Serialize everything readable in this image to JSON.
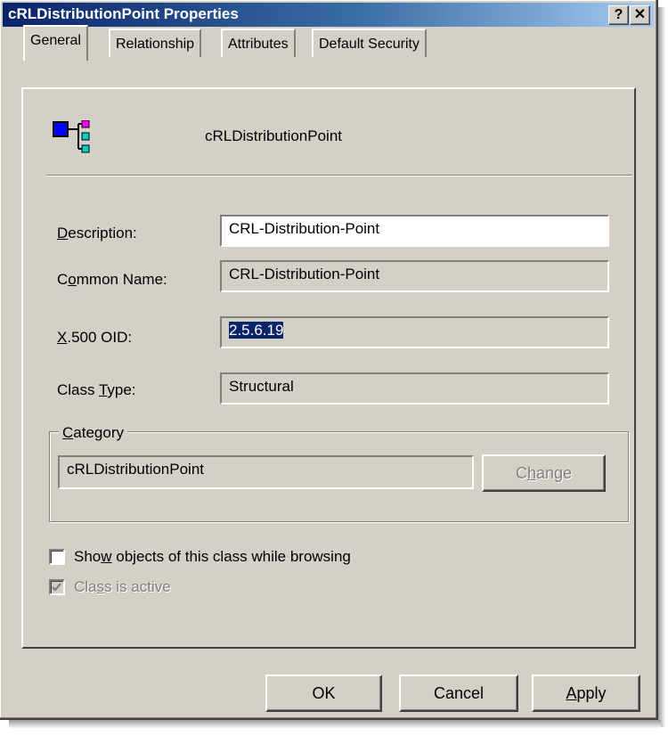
{
  "window": {
    "title": "cRLDistributionPoint Properties",
    "help_label": "?",
    "close_label": "✕"
  },
  "tabs": [
    {
      "label": "General",
      "active": true
    },
    {
      "label": "Relationship",
      "active": false
    },
    {
      "label": "Attributes",
      "active": false
    },
    {
      "label": "Default Security",
      "active": false
    }
  ],
  "header": {
    "class_name": "cRLDistributionPoint",
    "icon": "class-hierarchy-icon"
  },
  "fields": {
    "description": {
      "label_pre": "",
      "label_key": "D",
      "label_post": "escription:",
      "value": "CRL-Distribution-Point"
    },
    "common_name": {
      "label_pre": "C",
      "label_key": "o",
      "label_post": "mmon Name:",
      "value": "CRL-Distribution-Point"
    },
    "oid": {
      "label_pre": "",
      "label_key": "X",
      "label_post": ".500 OID:",
      "value": "2.5.6.19"
    },
    "class_type": {
      "label_pre": "Class ",
      "label_key": "T",
      "label_post": "ype:",
      "value": "Structural"
    }
  },
  "category": {
    "title_key": "C",
    "title_post": "ategory",
    "value": "cRLDistributionPoint",
    "change_pre": "C",
    "change_key": "h",
    "change_post": "ange"
  },
  "options": {
    "show_objects": {
      "pre": "Sho",
      "key": "w",
      "post": " objects of this class while browsing",
      "checked": false
    },
    "class_active": {
      "pre": "Cla",
      "key": "s",
      "post": "s is active",
      "checked": true,
      "disabled": true
    }
  },
  "buttons": {
    "ok": "OK",
    "cancel": "Cancel",
    "apply_key": "A",
    "apply_post": "pply"
  },
  "colors": {
    "face": "#d4d0c8",
    "title_start": "#0a246a",
    "title_end": "#a6caf0",
    "selection": "#0a246a"
  }
}
